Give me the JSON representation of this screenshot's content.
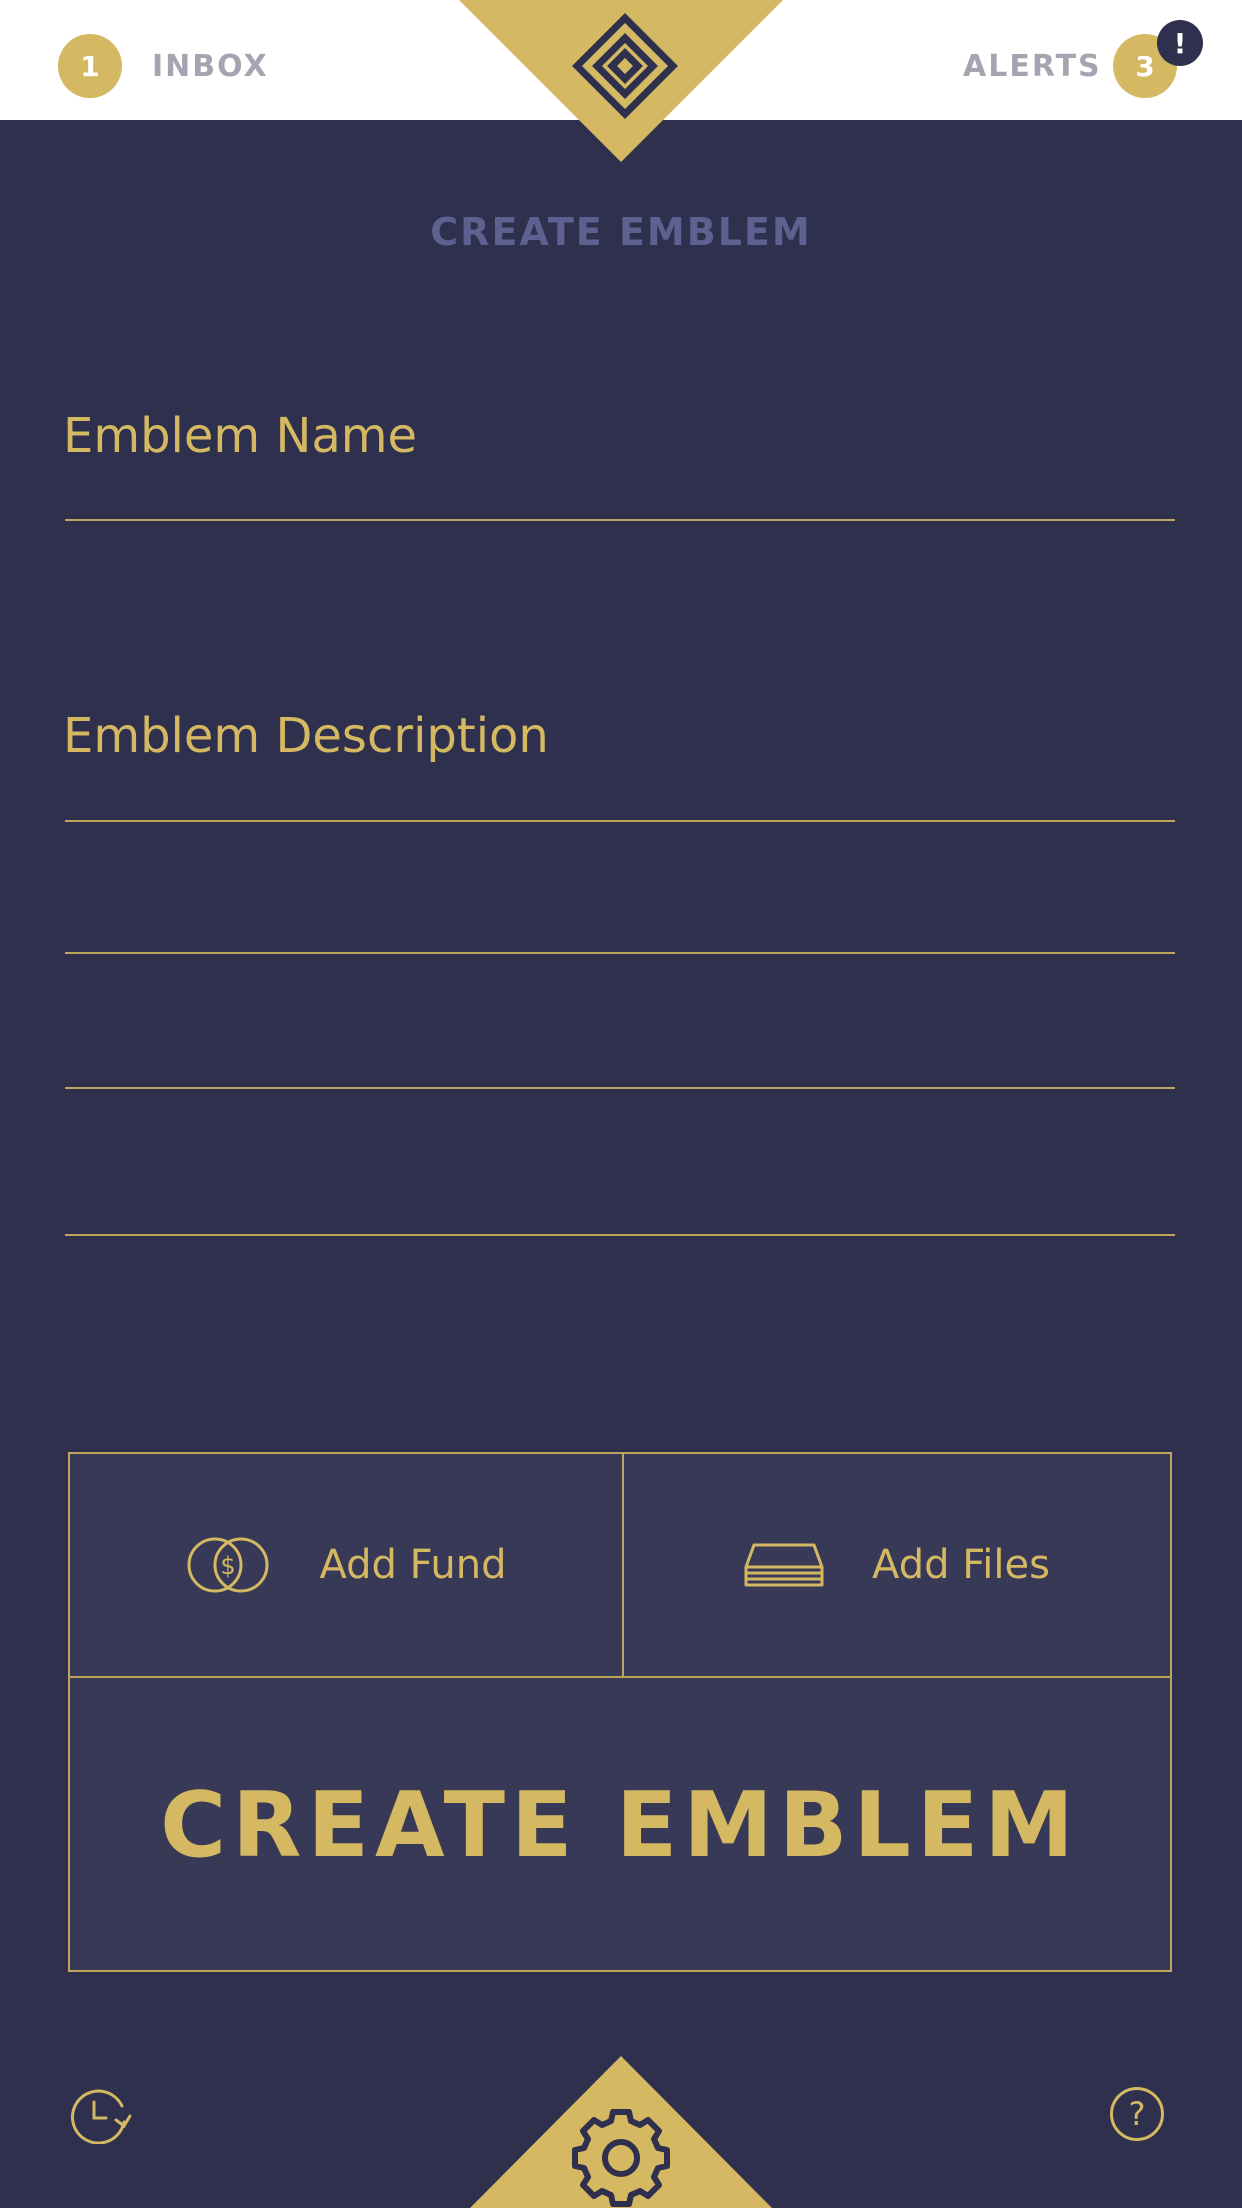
{
  "header": {
    "inbox": {
      "count": "1",
      "label": "INBOX"
    },
    "alerts": {
      "count": "3",
      "label": "ALERTS",
      "indicator": "!"
    },
    "logo_icon": "emblem-logo-icon"
  },
  "page": {
    "title": "CREATE EMBLEM"
  },
  "form": {
    "name_label": "Emblem Name",
    "description_label": "Emblem Description"
  },
  "actions": {
    "add_fund": {
      "label": "Add Fund",
      "icon": "fund-coin-icon"
    },
    "add_files": {
      "label": "Add Files",
      "icon": "stacked-files-icon"
    },
    "create": {
      "label": "CREATE EMBLEM"
    }
  },
  "footer": {
    "history_icon": "history-icon",
    "settings_icon": "gear-icon",
    "help_icon": "help-icon",
    "help_glyph": "?"
  },
  "colors": {
    "background": "#2e304d",
    "accent_gold": "#d4b862",
    "header_bg": "#ffffff",
    "title_muted": "#5c6190",
    "nav_text": "#a3a6b2"
  }
}
